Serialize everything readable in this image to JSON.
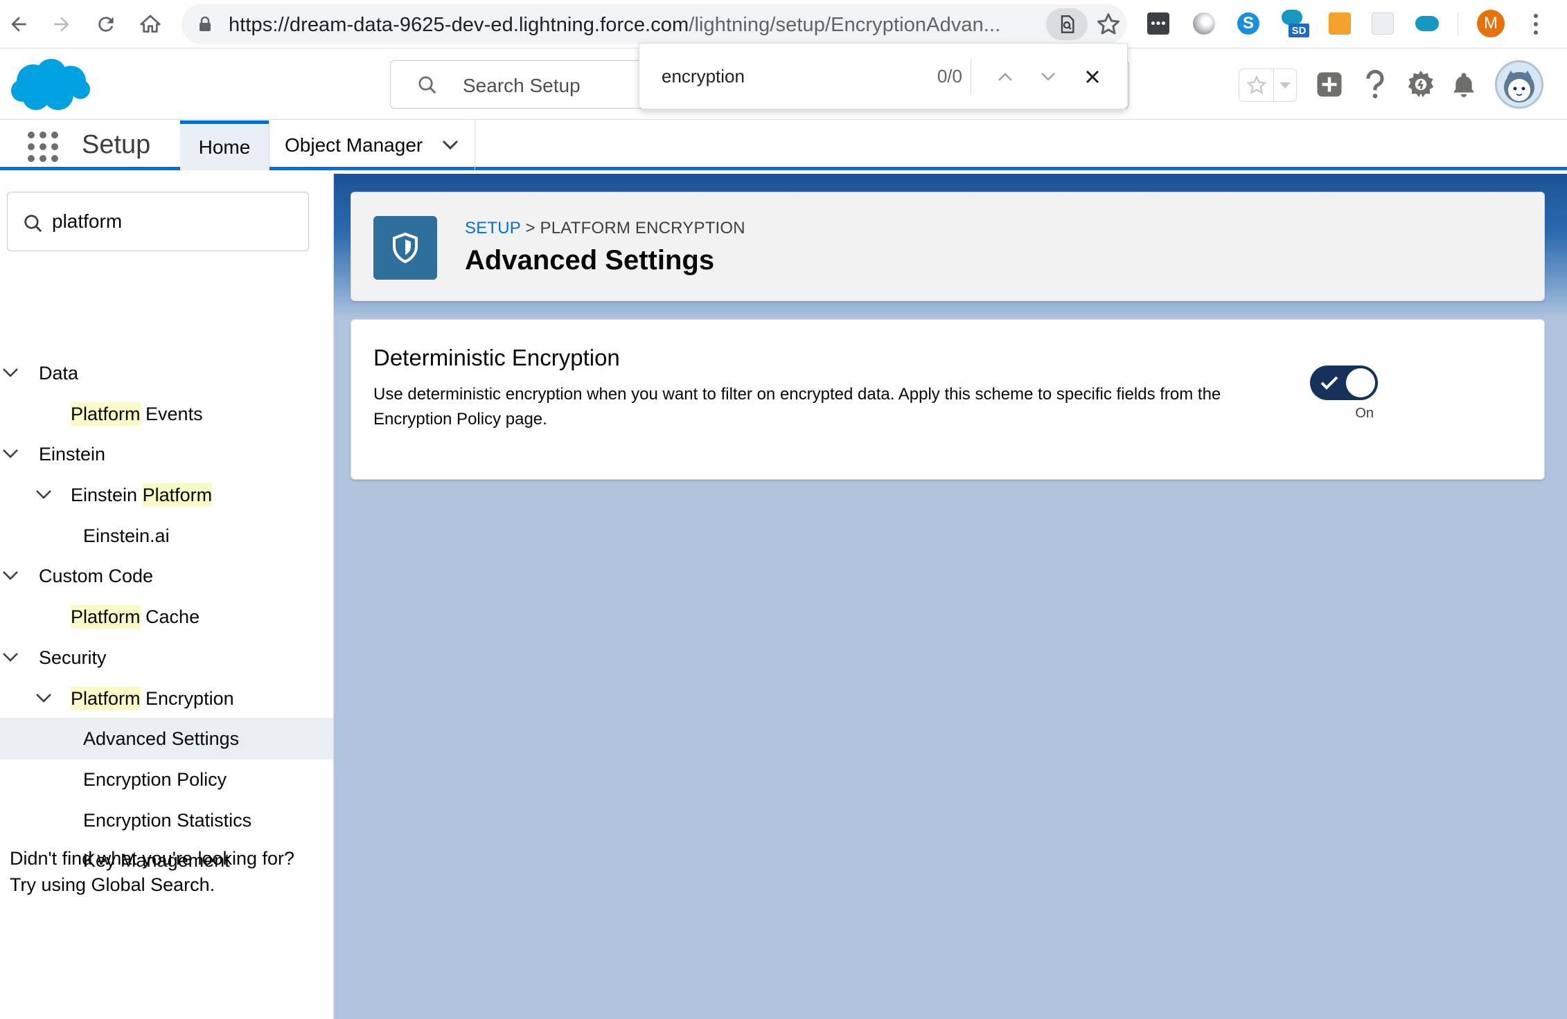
{
  "browser": {
    "url_host": "https://dream-data-9625-dev-ed.lightning.force.com",
    "url_path": "/lightning/setup/EncryptionAdvan...",
    "profile_initial": "M",
    "extensions": [
      "extension-1",
      "extension-2",
      "extension-3",
      "extension-salesforce-devtools",
      "extension-5",
      "extension-6",
      "extension-7"
    ]
  },
  "find_bar": {
    "query": "encryption",
    "count": "0/0"
  },
  "header": {
    "search_placeholder": "Search Setup"
  },
  "context_bar": {
    "app_name": "Setup",
    "tabs": [
      {
        "label": "Home",
        "active": true
      },
      {
        "label": "Object Manager",
        "active": false
      }
    ]
  },
  "sidebar": {
    "quick_find_value": "platform",
    "tree": [
      {
        "label_pre": "",
        "label_hl": "",
        "label_post": "Data",
        "level": 0,
        "expanded": true
      },
      {
        "label_pre": "",
        "label_hl": "Platform",
        "label_post": " Events",
        "level": 1
      },
      {
        "label_pre": "",
        "label_hl": "",
        "label_post": "Einstein",
        "level": 0,
        "expanded": true
      },
      {
        "label_pre": "Einstein ",
        "label_hl": "Platform",
        "label_post": "",
        "level": 1,
        "expanded": true
      },
      {
        "label_pre": "",
        "label_hl": "",
        "label_post": "Einstein.ai",
        "level": 2
      },
      {
        "label_pre": "",
        "label_hl": "",
        "label_post": "Custom Code",
        "level": 0,
        "expanded": true
      },
      {
        "label_pre": "",
        "label_hl": "Platform",
        "label_post": " Cache",
        "level": 1
      },
      {
        "label_pre": "",
        "label_hl": "",
        "label_post": "Security",
        "level": 0,
        "expanded": true
      },
      {
        "label_pre": "",
        "label_hl": "Platform",
        "label_post": " Encryption",
        "level": 1,
        "expanded": true
      },
      {
        "label_pre": "",
        "label_hl": "",
        "label_post": "Advanced Settings",
        "level": 2,
        "selected": true
      },
      {
        "label_pre": "",
        "label_hl": "",
        "label_post": "Encryption Policy",
        "level": 2
      },
      {
        "label_pre": "",
        "label_hl": "",
        "label_post": "Encryption Statistics",
        "level": 2
      },
      {
        "label_pre": "",
        "label_hl": "",
        "label_post": "Key Management",
        "level": 2
      }
    ],
    "help_line1": "Didn't find what you're looking for?",
    "help_line2": "Try using Global Search."
  },
  "page": {
    "breadcrumb_link": "SETUP",
    "breadcrumb_sep": " > ",
    "breadcrumb_current": "PLATFORM ENCRYPTION",
    "title": "Advanced Settings"
  },
  "settings": {
    "deterministic": {
      "title": "Deterministic Encryption",
      "description": "Use deterministic encryption when you want to filter on encrypted data. Apply this scheme to specific fields from the Encryption Policy page.",
      "enabled": true,
      "state_label": "On"
    }
  },
  "colors": {
    "brand": "#0070d2",
    "toggle_on": "#16325c",
    "page_icon": "#2e6f9b",
    "highlight": "#fbf9c7",
    "main_bg": "#b0c4df"
  }
}
